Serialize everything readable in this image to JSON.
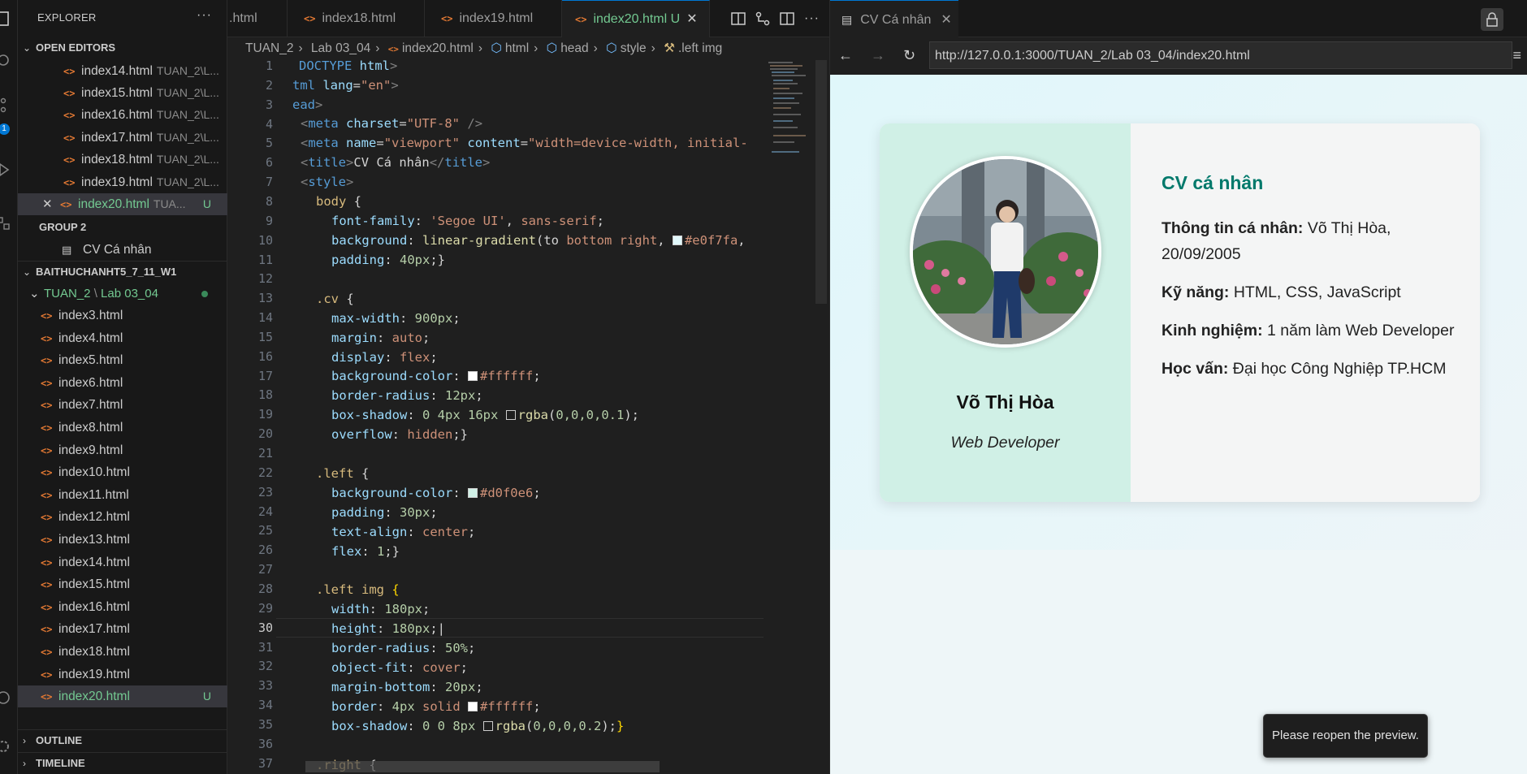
{
  "explorer": {
    "title": "EXPLORER",
    "more": "···",
    "open_editors_header": "OPEN EDITORS",
    "open_editors": [
      {
        "name": "index14.html",
        "desc": "TUAN_2\\L..."
      },
      {
        "name": "index15.html",
        "desc": "TUAN_2\\L..."
      },
      {
        "name": "index16.html",
        "desc": "TUAN_2\\L..."
      },
      {
        "name": "index17.html",
        "desc": "TUAN_2\\L..."
      },
      {
        "name": "index18.html",
        "desc": "TUAN_2\\L..."
      },
      {
        "name": "index19.html",
        "desc": "TUAN_2\\L..."
      },
      {
        "name": "index20.html",
        "desc": "TUA...",
        "status": "U"
      }
    ],
    "group2_header": "GROUP 2",
    "group2_item": "CV Cá nhân",
    "workspace_header": "BAITHUCHANHT5_7_11_W1",
    "folder": {
      "root": "TUAN_2",
      "sep": "\\",
      "sub": "Lab 03_04"
    },
    "files": [
      "index3.html",
      "index4.html",
      "index5.html",
      "index6.html",
      "index7.html",
      "index8.html",
      "index9.html",
      "index10.html",
      "index11.html",
      "index12.html",
      "index13.html",
      "index14.html",
      "index15.html",
      "index16.html",
      "index17.html",
      "index18.html",
      "index19.html",
      "index20.html"
    ],
    "file_status": "U",
    "outline": "OUTLINE",
    "timeline": "TIMELINE",
    "activity_badge": "1"
  },
  "editor": {
    "tabs": [
      {
        "label": ".html"
      },
      {
        "label": "index18.html"
      },
      {
        "label": "index19.html"
      },
      {
        "label": "index20.html",
        "status": "U",
        "close": "✕"
      }
    ],
    "breadcrumb": [
      "TUAN_2",
      "Lab 03_04",
      "index20.html",
      "html",
      "head",
      "style",
      ".left img"
    ],
    "current_line": 30,
    "line_numbers": [
      "1",
      "2",
      "3",
      "4",
      "5",
      "6",
      "7",
      "8",
      "9",
      "10",
      "11",
      "12",
      "13",
      "14",
      "15",
      "16",
      "17",
      "18",
      "19",
      "20",
      "21",
      "22",
      "23",
      "24",
      "25",
      "26",
      "27",
      "28",
      "29",
      "30",
      "31",
      "32",
      "33",
      "34",
      "35",
      "36",
      "37"
    ]
  },
  "preview": {
    "tab_title": "CV Cá nhân",
    "tab_close": "✕",
    "url": "http://127.0.0.1:3000/TUAN_2/Lab 03_04/index20.html",
    "cv": {
      "name": "Võ Thị Hòa",
      "role": "Web Developer",
      "heading": "CV cá nhân",
      "items": [
        {
          "label": "Thông tin cá nhân:",
          "value": " Võ Thị Hòa, 20/09/2005"
        },
        {
          "label": "Kỹ năng:",
          "value": " HTML, CSS, JavaScript"
        },
        {
          "label": "Kinh nghiệm:",
          "value": " 1 năm làm Web Developer"
        },
        {
          "label": "Học vấn:",
          "value": " Đại học Công Nghiệp TP.HCM"
        }
      ]
    },
    "toast": "Please reopen the preview."
  },
  "colors": {
    "accent_blue": "#0078d4",
    "git_untracked": "#73c991",
    "html_icon": "#e37933",
    "cv_left_bg": "#d0f0e6",
    "cv_heading": "#00796b"
  }
}
